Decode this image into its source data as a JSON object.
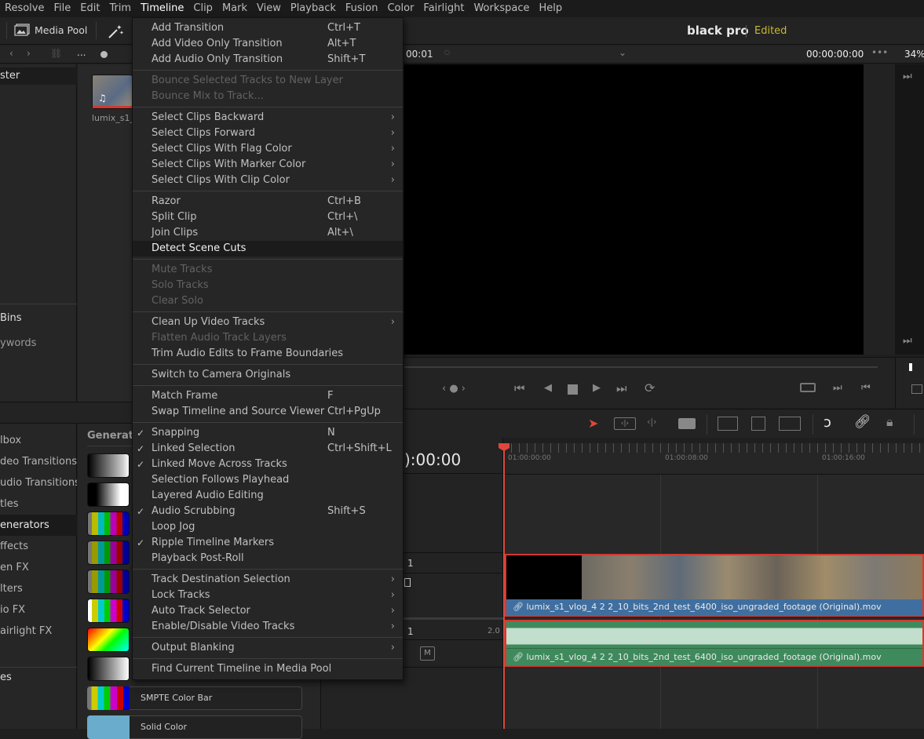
{
  "menubar": {
    "items": [
      "Resolve",
      "File",
      "Edit",
      "Trim",
      "Timeline",
      "Clip",
      "Mark",
      "View",
      "Playback",
      "Fusion",
      "Color",
      "Fairlight",
      "Workspace",
      "Help"
    ],
    "active": "Timeline"
  },
  "toolbar": {
    "media_pool_label": "Media Pool",
    "project_name": "black pro",
    "project_status": "Edited"
  },
  "bar2": {
    "more_label": "...",
    "source_tc": "00:01",
    "viewer_tc": "00:00:00:00",
    "zoom": "34%"
  },
  "bins": {
    "master": "ster",
    "smart_bins": "Bins",
    "keywords": "ywords"
  },
  "media_pool": {
    "clip_name": "lumix_s1_"
  },
  "effects": {
    "items": [
      "lbox",
      "deo Transitions",
      "udio Transitions",
      "tles",
      "enerators",
      "ffects",
      "en FX",
      "lters",
      "io FX",
      "airlight FX"
    ],
    "selected_index": 4,
    "bottom_item": "es",
    "panel_title": "Generato",
    "generators": [
      "SMPTE Color Bar",
      "Solid Color"
    ]
  },
  "timeline_menu": {
    "items": [
      {
        "label": "Add Transition",
        "shortcut": "Ctrl+T"
      },
      {
        "label": "Add Video Only Transition",
        "shortcut": "Alt+T"
      },
      {
        "label": "Add Audio Only Transition",
        "shortcut": "Shift+T"
      },
      {
        "sep": true
      },
      {
        "label": "Bounce Selected Tracks to New Layer",
        "disabled": true
      },
      {
        "label": "Bounce Mix to Track...",
        "disabled": true
      },
      {
        "sep": true
      },
      {
        "label": "Select Clips Backward",
        "submenu": true
      },
      {
        "label": "Select Clips Forward",
        "submenu": true
      },
      {
        "label": "Select Clips With Flag Color",
        "submenu": true
      },
      {
        "label": "Select Clips With Marker Color",
        "submenu": true
      },
      {
        "label": "Select Clips With Clip Color",
        "submenu": true
      },
      {
        "sep": true
      },
      {
        "label": "Razor",
        "shortcut": "Ctrl+B"
      },
      {
        "label": "Split Clip",
        "shortcut": "Ctrl+\\"
      },
      {
        "label": "Join Clips",
        "shortcut": "Alt+\\"
      },
      {
        "label": "Detect Scene Cuts",
        "highlighted": true
      },
      {
        "sep": true
      },
      {
        "label": "Mute Tracks",
        "disabled": true
      },
      {
        "label": "Solo Tracks",
        "disabled": true
      },
      {
        "label": "Clear Solo",
        "disabled": true
      },
      {
        "sep": true
      },
      {
        "label": "Clean Up Video Tracks",
        "submenu": true
      },
      {
        "label": "Flatten Audio Track Layers",
        "disabled": true
      },
      {
        "label": "Trim Audio Edits to Frame Boundaries"
      },
      {
        "sep": true
      },
      {
        "label": "Switch to Camera Originals"
      },
      {
        "sep": true
      },
      {
        "label": "Match Frame",
        "shortcut": "F"
      },
      {
        "label": "Swap Timeline and Source Viewer",
        "shortcut": "Ctrl+PgUp"
      },
      {
        "sep": true
      },
      {
        "label": "Snapping",
        "shortcut": "N",
        "checked": true
      },
      {
        "label": "Linked Selection",
        "shortcut": "Ctrl+Shift+L",
        "checked": true
      },
      {
        "label": "Linked Move Across Tracks",
        "checked": true
      },
      {
        "label": "Selection Follows Playhead"
      },
      {
        "label": "Layered Audio Editing"
      },
      {
        "label": "Audio Scrubbing",
        "shortcut": "Shift+S",
        "checked": true
      },
      {
        "label": "Loop Jog"
      },
      {
        "label": "Ripple Timeline Markers",
        "checked": true
      },
      {
        "label": "Playback Post-Roll"
      },
      {
        "sep": true
      },
      {
        "label": "Track Destination Selection",
        "submenu": true
      },
      {
        "label": "Lock Tracks",
        "submenu": true
      },
      {
        "label": "Auto Track Selector",
        "submenu": true
      },
      {
        "label": "Enable/Disable Video Tracks",
        "submenu": true
      },
      {
        "sep": true
      },
      {
        "label": "Output Blanking",
        "submenu": true
      },
      {
        "sep": true
      },
      {
        "label": "Find Current Timeline in Media Pool"
      }
    ]
  },
  "timeline": {
    "timecode": "):00:00",
    "ruler_labels": [
      "01:00:00:00",
      "01:00:08:00",
      "01:00:16:00"
    ],
    "video_track_num": "1",
    "audio_track_num": "1",
    "audio_channels": "2.0",
    "mute_label": "M",
    "video_clip": "lumix_s1_vlog_4 2 2_10_bits_2nd_test_6400_iso_ungraded_footage (Original).mov",
    "audio_clip": "lumix_s1_vlog_4 2 2_10_bits_2nd_test_6400_iso_ungraded_footage (Original).mov"
  },
  "colors": {
    "playhead": "#e0463c",
    "video_clip_bar": "#3f6fa0",
    "audio_clip": "#3f8a5c",
    "edited": "#c8b830"
  }
}
